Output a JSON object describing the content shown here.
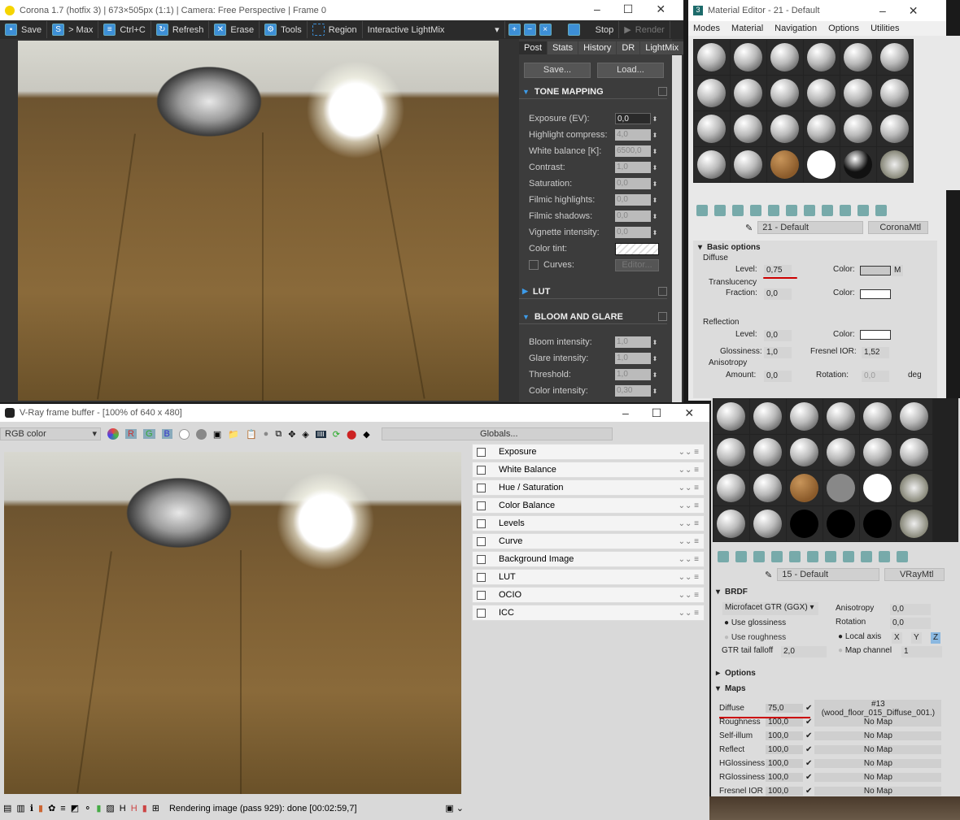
{
  "corona": {
    "title": "Corona 1.7 (hotfix 3) | 673×505px (1:1) | Camera: Free Perspective | Frame 0",
    "toolbar": {
      "save": "Save",
      "max": "> Max",
      "copy": "Ctrl+C",
      "refresh": "Refresh",
      "erase": "Erase",
      "tools": "Tools",
      "region": "Region",
      "mode": "Interactive LightMix",
      "stop": "Stop",
      "render": "Render"
    },
    "tabs": [
      "Post",
      "Stats",
      "History",
      "DR",
      "LightMix"
    ],
    "save_btn": "Save...",
    "load_btn": "Load...",
    "tone_mapping": "TONE MAPPING",
    "tone_rows": [
      {
        "label": "Exposure (EV):",
        "value": "0,0"
      },
      {
        "label": "Highlight compress:",
        "value": "4,0"
      },
      {
        "label": "White balance [K]:",
        "value": "6500,0"
      },
      {
        "label": "Contrast:",
        "value": "1,0"
      },
      {
        "label": "Saturation:",
        "value": "0,0"
      },
      {
        "label": "Filmic highlights:",
        "value": "0,0"
      },
      {
        "label": "Filmic shadows:",
        "value": "0,0"
      },
      {
        "label": "Vignette intensity:",
        "value": "0,0"
      }
    ],
    "color_tint": "Color tint:",
    "curves": "Curves:",
    "editor": "Editor...",
    "lut": "LUT",
    "bloom": "BLOOM AND GLARE",
    "bloom_rows": [
      {
        "label": "Bloom intensity:",
        "value": "1,0"
      },
      {
        "label": "Glare intensity:",
        "value": "1,0"
      },
      {
        "label": "Threshold:",
        "value": "1,0"
      },
      {
        "label": "Color intensity:",
        "value": "0,30"
      }
    ]
  },
  "mat1": {
    "title": "Material Editor - 21 - Default",
    "menu": [
      "Modes",
      "Material",
      "Navigation",
      "Options",
      "Utilities"
    ],
    "name": "21 - Default",
    "type": "CoronaMtl",
    "basic_options": "Basic options",
    "diffuse": "Diffuse",
    "level_lbl": "Level:",
    "diffuse_level": "0,75",
    "color_lbl": "Color:",
    "m": "M",
    "translucency": "Translucency",
    "fraction_lbl": "Fraction:",
    "fraction": "0,0",
    "reflection": "Reflection",
    "refl_level": "0,0",
    "gloss_lbl": "Glossiness:",
    "gloss": "1,0",
    "fresnel_lbl": "Fresnel IOR:",
    "fresnel": "1,52",
    "anisotropy": "Anisotropy",
    "amount_lbl": "Amount:",
    "amount": "0,0",
    "rotation_lbl": "Rotation:",
    "rotation": "0,0",
    "deg": "deg"
  },
  "vray": {
    "title": "V-Ray frame buffer - [100% of 640 x 480]",
    "channel": "RGB color",
    "globals": "Globals...",
    "layers": [
      "Exposure",
      "White Balance",
      "Hue / Saturation",
      "Color Balance",
      "Levels",
      "Curve",
      "Background Image",
      "LUT",
      "OCIO",
      "ICC"
    ],
    "status": "Rendering image (pass 929): done [00:02:59,7]"
  },
  "mat2": {
    "name": "15 - Default",
    "type": "VRayMtl",
    "brdf": "BRDF",
    "brdf_type": "Microfacet GTR (GGX)",
    "use_gloss": "Use glossiness",
    "use_rough": "Use roughness",
    "gtr_lbl": "GTR tail falloff",
    "gtr": "2,0",
    "aniso_lbl": "Anisotropy",
    "aniso": "0,0",
    "rot_lbl": "Rotation",
    "rot": "0,0",
    "local_axis": "Local axis",
    "axes": [
      "X",
      "Y",
      "Z"
    ],
    "map_channel": "Map channel",
    "map_channel_val": "1",
    "options": "Options",
    "maps": "Maps",
    "map_rows": [
      {
        "name": "Diffuse",
        "value": "75,0",
        "map": "#13 (wood_floor_015_Diffuse_001.)"
      },
      {
        "name": "Roughness",
        "value": "100,0",
        "map": "No Map"
      },
      {
        "name": "Self-illum",
        "value": "100,0",
        "map": "No Map"
      },
      {
        "name": "Reflect",
        "value": "100,0",
        "map": "No Map"
      },
      {
        "name": "HGlossiness",
        "value": "100,0",
        "map": "No Map"
      },
      {
        "name": "RGlossiness",
        "value": "100,0",
        "map": "No Map"
      },
      {
        "name": "Fresnel IOR",
        "value": "100,0",
        "map": "No Map"
      }
    ]
  }
}
